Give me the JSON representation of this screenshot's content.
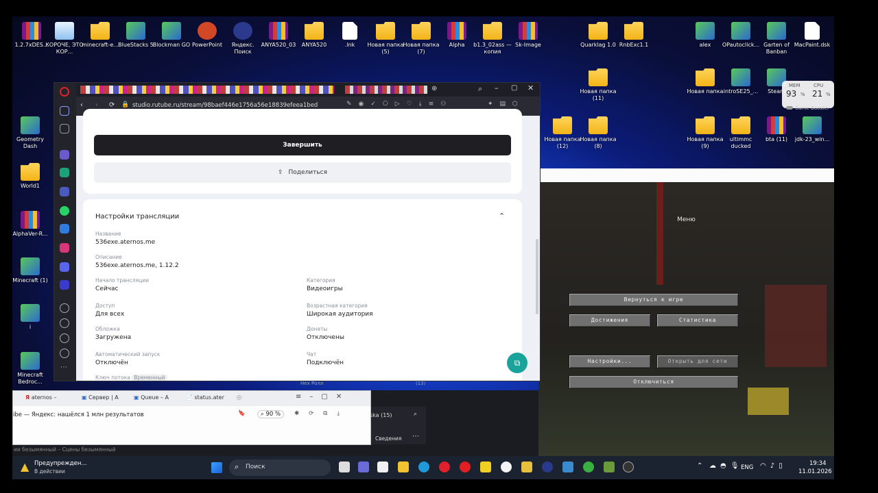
{
  "desktop_icons": [
    {
      "label": "1.2.7xDES...",
      "kind": "rar"
    },
    {
      "label": "КОРОЧЕ, ЭТО КОР...",
      "kind": "recycle"
    },
    {
      "label": "minecraft-e...",
      "kind": "folder"
    },
    {
      "label": "BlueStacks 5",
      "kind": "app"
    },
    {
      "label": "Blockman GO",
      "kind": "app"
    },
    {
      "label": "PowerPoint",
      "kind": "ppt"
    },
    {
      "label": "Яндекс. Поиск",
      "kind": "yandex"
    },
    {
      "label": "ANYA520_03",
      "kind": "rar"
    },
    {
      "label": "ANYA520",
      "kind": "folder"
    },
    {
      "label": ".lnk",
      "kind": "file"
    },
    {
      "label": "Новая папка (5)",
      "kind": "folder"
    },
    {
      "label": "Новая папка (7)",
      "kind": "folder"
    },
    {
      "label": "Alpha",
      "kind": "rar"
    },
    {
      "label": "b1.3_02ass — копия",
      "kind": "folder"
    },
    {
      "label": "Sk-Image",
      "kind": "rar"
    },
    {
      "label": "Quarklag 1.0",
      "kind": "folder"
    },
    {
      "label": "RnbExc1.1",
      "kind": "folder"
    },
    {
      "label": "alex",
      "kind": "app"
    },
    {
      "label": "OPautoclick...",
      "kind": "app"
    },
    {
      "label": "Garten of Banban",
      "kind": "app"
    },
    {
      "label": "MacPaint.dsk",
      "kind": "file"
    },
    {
      "label": "Новая папка (11)",
      "kind": "folder"
    },
    {
      "label": "Новая папка",
      "kind": "folder"
    },
    {
      "label": "introSE25_...",
      "kind": "app"
    },
    {
      "label": "Steam",
      "kind": "app"
    },
    {
      "label": "Geometry Dash",
      "kind": "app"
    },
    {
      "label": "World1",
      "kind": "folder"
    },
    {
      "label": "AlphaVer-R...",
      "kind": "rar"
    },
    {
      "label": "Minecraft (1)",
      "kind": "app"
    },
    {
      "label": "i",
      "kind": "app"
    },
    {
      "label": "Minecraft Bedroc...",
      "kind": "app"
    },
    {
      "label": "Новая папка (12)",
      "kind": "folder"
    },
    {
      "label": "Новая папка (8)",
      "kind": "folder"
    },
    {
      "label": "Новая папка (9)",
      "kind": "folder"
    },
    {
      "label": "ultimmc ducked",
      "kind": "folder"
    },
    {
      "label": "bta (11)",
      "kind": "rar"
    },
    {
      "label": "jdk-23_win...",
      "kind": "app"
    }
  ],
  "perf_widget": {
    "mem_label": "MEM",
    "mem_value": "93",
    "cpu_label": "CPU",
    "cpu_value": "21",
    "unit": "%",
    "booster": "Game Booster"
  },
  "browser": {
    "url": "studio.rutube.ru/stream/98baef446e1756a56e18839efeea1bed",
    "finish_button": "Завершить",
    "share_button": "Поделиться",
    "section_title": "Настройки трансляции",
    "fields": [
      {
        "label": "Название",
        "value": "536exe.aternos.me"
      },
      {
        "label": "Описание",
        "value": "536exe.aternos.me, 1.12.2"
      },
      {
        "label": "Начало трансляции",
        "value": "Сейчас"
      },
      {
        "label": "Категория",
        "value": "Видеоигры"
      },
      {
        "label": "Доступ",
        "value": "Для всех"
      },
      {
        "label": "Возрастная категория",
        "value": "Широкая аудитория"
      },
      {
        "label": "Обложка",
        "value": "Загружена"
      },
      {
        "label": "Донаты",
        "value": "Отключены"
      },
      {
        "label": "Автоматический запуск",
        "value": "Отключён"
      },
      {
        "label": "Чат",
        "value": "Подключён"
      }
    ],
    "stream_key_label": "Ключ потока",
    "stream_key_tag": "Временный"
  },
  "minecraft": {
    "title": "Меню",
    "back": "Вернуться к игре",
    "achievements": "Достижения",
    "stats": "Статистика",
    "options": "Настройки...",
    "open_lan": "Открыть для сети",
    "disconnect": "Отключиться"
  },
  "browser2": {
    "tabs": [
      "aternos –",
      "Сервер | A",
      "Queue – A",
      "status.ater"
    ],
    "search_text": "ibe — Яндекс: нашёлся 1 млн результатов",
    "zoom": "90 %",
    "other_tab": "ska (15)",
    "svedenia": "Сведения",
    "hint1": "(13)",
    "hint2": "Нех Ролл"
  },
  "background_window_title": "ии безымянный – Сцены безымянный",
  "taskbar": {
    "notice_title": "Предупрежден...",
    "notice_sub": "В действии",
    "search": "Поиск",
    "lang": "ENG",
    "time": "19:34",
    "date": "11.01.2026"
  }
}
